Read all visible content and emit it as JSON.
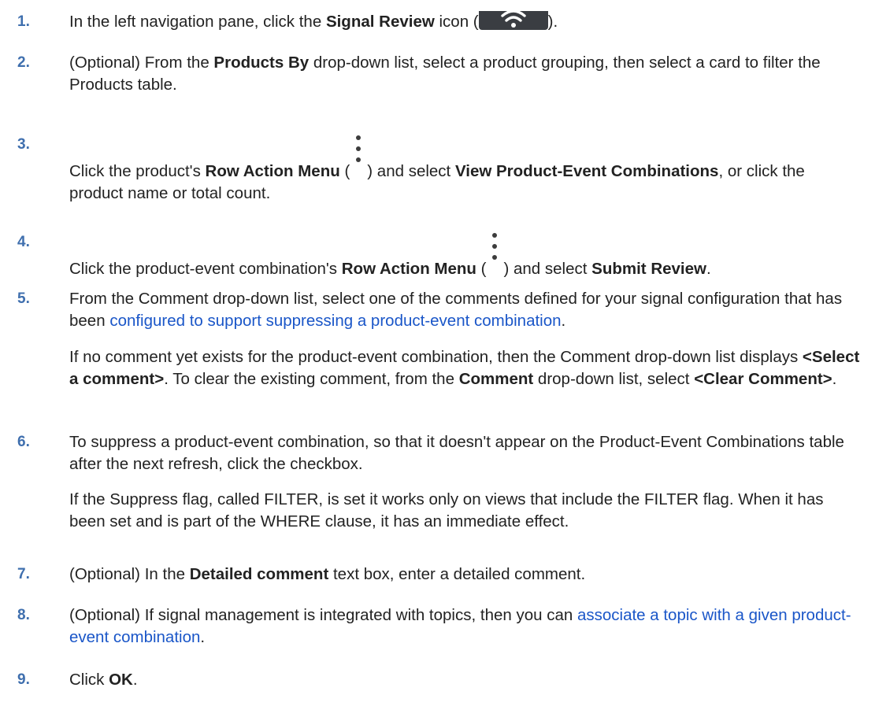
{
  "steps": [
    {
      "n": "1.",
      "a": "In the left navigation pane, click the ",
      "b1": "Signal Review",
      "c": " icon (",
      "d": ")."
    },
    {
      "n": "2.",
      "a": "(Optional) From the ",
      "b1": "Products By",
      "c": " drop-down list, select a product grouping, then select a card to filter the Products table."
    },
    {
      "n": "3.",
      "a": "Click the product's ",
      "b1": "Row Action Menu",
      "c": " (",
      "d": ") and select ",
      "b2": "View Product-Event Combinations",
      "e": ", or click the product name or total count."
    },
    {
      "n": "4.",
      "a": "Click the product-event combination's ",
      "b1": "Row Action Menu",
      "c": " (",
      "d": ") and select ",
      "b2": "Submit Review",
      "e": "."
    },
    {
      "n": "5.",
      "a": "From the Comment drop-down list, select one of the comments defined for your signal configuration that has been ",
      "link": "configured to support suppressing a product-event combination",
      "e": ".",
      "p2a": "If no comment yet exists for the product-event combination, then the Comment drop-down list displays ",
      "p2b1": "<Select a comment>",
      "p2c": ". To clear the existing comment, from the ",
      "p2b2": "Comment",
      "p2d": " drop-down list, select ",
      "p2b3": "<Clear Comment>",
      "p2e": "."
    },
    {
      "n": "6.",
      "a": "To suppress a product-event combination, so that it doesn't appear on the Product-Event Combinations table after the next refresh, click the checkbox.",
      "p2a": "If the Suppress flag, called FILTER, is set it works only on views that include the FILTER flag. When it has been set and is part of the WHERE clause, it has an immediate effect."
    },
    {
      "n": "7.",
      "a": "(Optional) In the ",
      "b1": "Detailed comment",
      "c": " text box, enter a detailed comment."
    },
    {
      "n": "8.",
      "a": "(Optional) If signal management is integrated with topics, then you can ",
      "link": "associate a topic with a given product-event combination",
      "e": "."
    },
    {
      "n": "9.",
      "a": "Click ",
      "b1": "OK",
      "c": "."
    }
  ],
  "icons": {
    "signal_review": "wifi-signal-icon",
    "row_action_menu": "kebab-menu-icon"
  },
  "colors": {
    "step_number": "#3f6fae",
    "link": "#1a56c8",
    "icon_bg": "#3a3d42"
  }
}
